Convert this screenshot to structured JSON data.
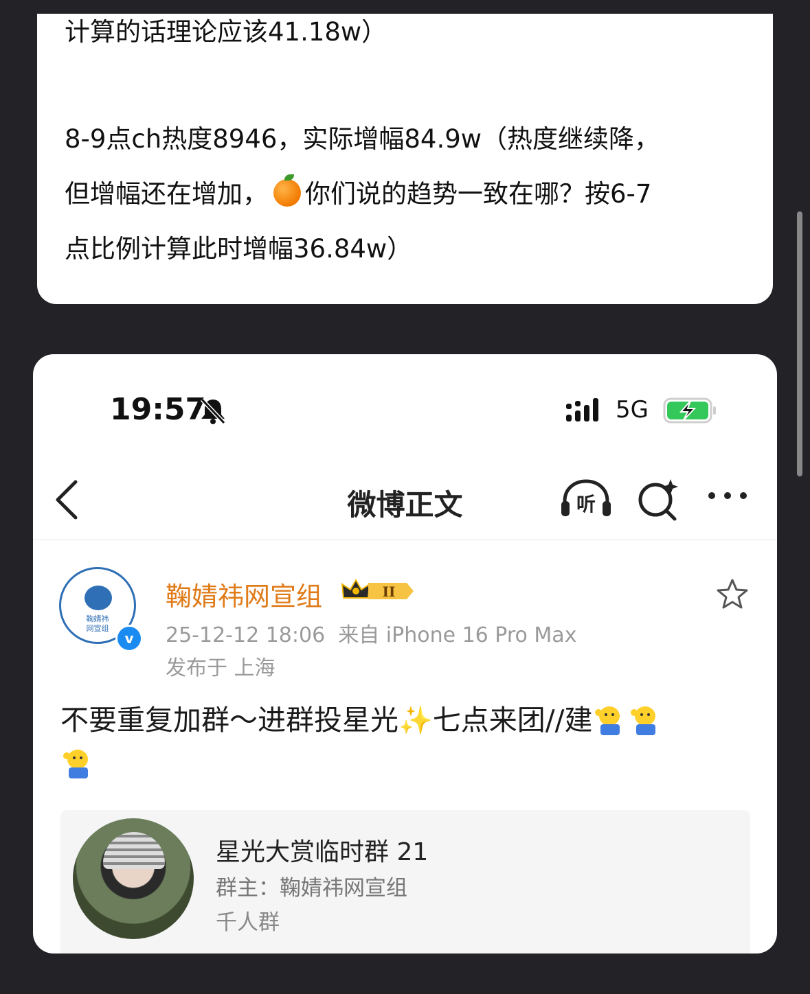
{
  "post_text": {
    "line1": "计算的话理论应该41.18w）",
    "line2": "8-9点ch热度8946，实际增幅84.9w（热度继续降，",
    "line3_a": "但增幅还在增加，",
    "line3_b": "你们说的趋势一致在哪？按6-7",
    "line4": "点比例计算此时增幅36.84w）"
  },
  "status_bar": {
    "time": "19:57",
    "network": "5G"
  },
  "nav": {
    "title": "微博正文",
    "listen_label": "听"
  },
  "post": {
    "author": "鞠婧祎网宣组",
    "badge_label": "II",
    "avatar_text": [
      "鞠婧祎",
      "网宣组"
    ],
    "verified_mark": "v",
    "datetime": "25-12-12 18:06",
    "source": "来自 iPhone 16 Pro Max",
    "location": "发布于 上海",
    "content_a": "不要重复加群～进群投星光",
    "content_b": "七点来团//建",
    "sparkle": "✨"
  },
  "group": {
    "name": "星光大赏临时群 21",
    "owner": "群主：鞠婧祎网宣组",
    "type": "千人群"
  },
  "colors": {
    "background": "#222227",
    "author": "#e07b19",
    "accent": "#1a8bf0"
  }
}
